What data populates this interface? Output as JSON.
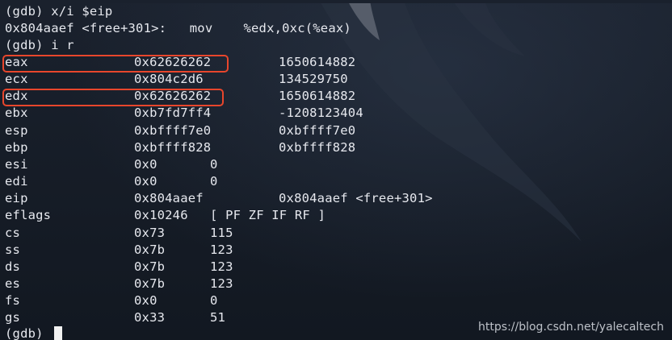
{
  "prompt_lines": {
    "x_cmd": "(gdb) x/i $eip",
    "instr": "0x804aaef <free+301>:   mov    %edx,0xc(%eax)",
    "i_r": "(gdb) i r",
    "final_prompt": "(gdb) "
  },
  "registers": [
    {
      "name": "eax",
      "hex": "0x62626262",
      "value": "1650614882"
    },
    {
      "name": "ecx",
      "hex": "0x804c2d6",
      "value": "134529750"
    },
    {
      "name": "edx",
      "hex": "0x62626262",
      "value": "1650614882"
    },
    {
      "name": "ebx",
      "hex": "0xb7fd7ff4",
      "value": "-1208123404"
    },
    {
      "name": "esp",
      "hex": "0xbffff7e0",
      "value": "0xbffff7e0"
    },
    {
      "name": "ebp",
      "hex": "0xbffff828",
      "value": "0xbffff828"
    },
    {
      "name": "esi",
      "hex": "0x0",
      "value": "0"
    },
    {
      "name": "edi",
      "hex": "0x0",
      "value": "0"
    },
    {
      "name": "eip",
      "hex": "0x804aaef",
      "value": "0x804aaef <free+301>"
    },
    {
      "name": "eflags",
      "hex": "0x10246",
      "value": "[ PF ZF IF RF ]"
    },
    {
      "name": "cs",
      "hex": "0x73",
      "value": "115"
    },
    {
      "name": "ss",
      "hex": "0x7b",
      "value": "123"
    },
    {
      "name": "ds",
      "hex": "0x7b",
      "value": "123"
    },
    {
      "name": "es",
      "hex": "0x7b",
      "value": "123"
    },
    {
      "name": "fs",
      "hex": "0x0",
      "value": "0"
    },
    {
      "name": "gs",
      "hex": "0x33",
      "value": "51"
    }
  ],
  "highlight_color": "#e8462c",
  "background_color": "#141a24",
  "text_color": "#e6e8ee",
  "watermark": "https://blog.csdn.net/yalecaltech"
}
